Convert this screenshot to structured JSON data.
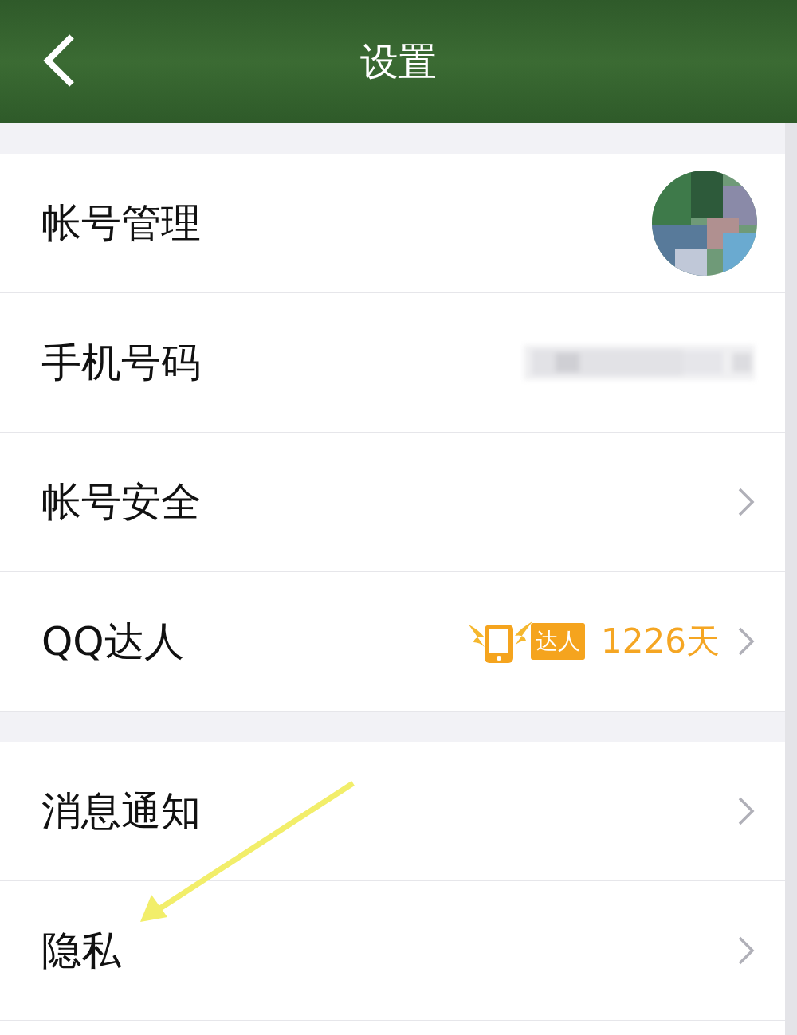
{
  "header": {
    "title": "设置"
  },
  "sections": [
    {
      "rows": [
        {
          "kind": "avatar",
          "label": "帐号管理"
        },
        {
          "kind": "blurred",
          "label": "手机号码"
        },
        {
          "kind": "chevron",
          "label": "帐号安全"
        },
        {
          "kind": "badge",
          "label": "QQ达人",
          "badge": "达人",
          "value": "1226天"
        }
      ]
    },
    {
      "rows": [
        {
          "kind": "chevron",
          "label": "消息通知"
        },
        {
          "kind": "chevron",
          "label": "隐私"
        }
      ]
    }
  ]
}
